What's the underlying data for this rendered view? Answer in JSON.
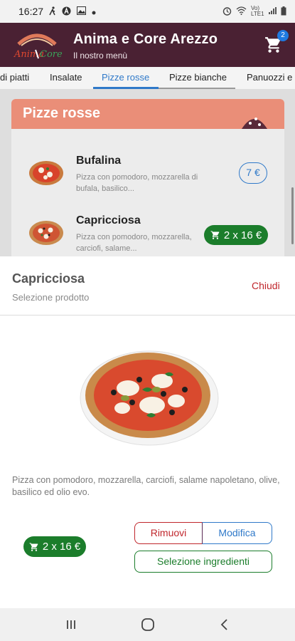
{
  "status_bar": {
    "time": "16:27",
    "left_icons": [
      "walk-icon",
      "a-icon",
      "image-icon",
      "dot-icon"
    ],
    "right_icons": [
      "alarm-icon",
      "wifi-icon",
      "volte-icon",
      "signal-icon",
      "battery-icon"
    ],
    "network_label": "Vo) LTE1"
  },
  "header": {
    "title": "Anima e Core Arezzo",
    "subtitle": "Il nostro menù",
    "logo_text": "Anima Core",
    "cart_count": "2",
    "colors": {
      "background": "#4a2133",
      "badge": "#1f7ae0"
    }
  },
  "tabs": [
    {
      "label": "di piatti",
      "active": false
    },
    {
      "label": "Insalate",
      "active": false
    },
    {
      "label": "Pizze rosse",
      "active": true
    },
    {
      "label": "Pizze bianche",
      "active": false
    },
    {
      "label": "Panuozzi e",
      "active": false
    }
  ],
  "menu_section": {
    "title": "Pizze rosse",
    "header_color": "#ea8e78",
    "items": [
      {
        "name": "Bufalina",
        "description": "Pizza con pomodoro, mozzarella di bufala, basilico...",
        "price": "7 €"
      },
      {
        "name": "Capricciosa",
        "description": "Pizza con pomodoro, mozzarella, carciofi, salame...",
        "price": "2 x 16 €"
      }
    ]
  },
  "sheet": {
    "title": "Capricciosa",
    "subtitle": "Selezione prodotto",
    "close_label": "Chiudi",
    "description": "Pizza con pomodoro, mozzarella, carciofi, salame napoletano, olive, basilico ed olio evo.",
    "price_label": "2 x 16 €",
    "remove_label": "Rimuovi",
    "edit_label": "Modifica",
    "ingredients_label": "Selezione ingredienti",
    "colors": {
      "green": "#1b7d2b",
      "red": "#c0262c",
      "blue": "#2f79c9"
    }
  },
  "nav_bar": {
    "icons": [
      "recents-icon",
      "home-icon",
      "back-icon"
    ]
  }
}
